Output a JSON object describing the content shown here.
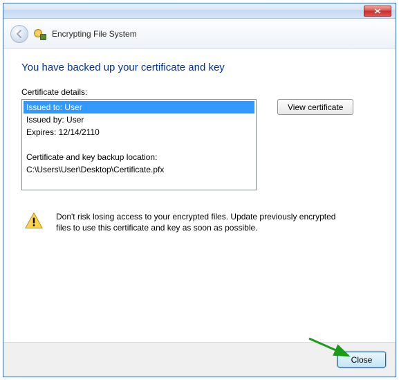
{
  "header": {
    "title": "Encrypting File System"
  },
  "main": {
    "heading": "You have backed up your certificate and key",
    "details_label": "Certificate details:",
    "view_cert_label": "View certificate"
  },
  "cert": {
    "issued_to": "Issued to: User",
    "issued_by": "Issued by: User",
    "expires": "Expires: 12/14/2110",
    "backup_label": "Certificate and key backup location:",
    "backup_path": "C:\\Users\\User\\Desktop\\Certificate.pfx"
  },
  "warning": {
    "text": "Don't risk losing access to your encrypted files. Update previously encrypted files to use this certificate and key as soon as possible."
  },
  "footer": {
    "close_label": "Close"
  }
}
